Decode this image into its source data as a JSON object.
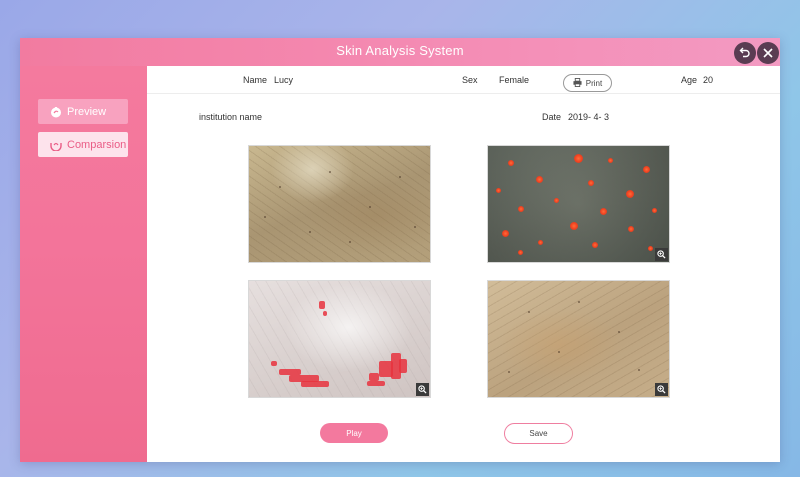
{
  "window": {
    "title": "Skin Analysis System",
    "back_icon": "back-arrow-icon",
    "close_icon": "close-icon"
  },
  "sidebar": {
    "items": [
      {
        "label": "Preview",
        "icon": "hand-icon",
        "active": true
      },
      {
        "label": "Comparsion",
        "icon": "hand-icon",
        "active": false
      }
    ]
  },
  "patient": {
    "name_label": "Name",
    "name_value": "Lucy",
    "sex_label": "Sex",
    "sex_value": "Female",
    "age_label": "Age",
    "age_value": "20"
  },
  "report": {
    "institution": "institution name",
    "date_label": "Date",
    "date_value": "2019- 4- 3",
    "print_label": "Print"
  },
  "images": [
    {
      "name": "skin-photo-normal",
      "zoom": false
    },
    {
      "name": "skin-photo-uv-spots",
      "zoom": true
    },
    {
      "name": "skin-photo-sensitivity",
      "zoom": true
    },
    {
      "name": "skin-photo-polarized",
      "zoom": true
    }
  ],
  "actions": {
    "play_label": "Play",
    "save_label": "Save"
  },
  "colors": {
    "accent": "#f3799e",
    "sidebar": "#f47a9e",
    "titlebar": "#f48ab2"
  }
}
